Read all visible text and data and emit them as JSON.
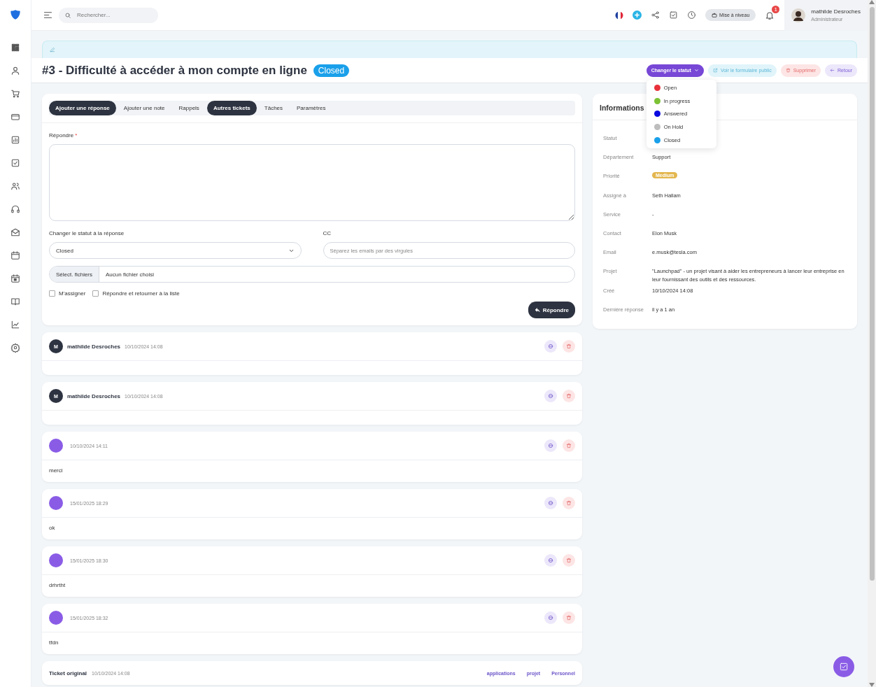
{
  "topbar": {
    "search": {
      "placeholder": "Rechercher..."
    },
    "upgrade_button": "Mise à niveau",
    "notifications_count": "1",
    "user": {
      "name": "mathilde Desroches",
      "role": "Administrateur"
    }
  },
  "ticket": {
    "title": "#3 - Difficulté à accéder à mon compte en ligne",
    "status": "Closed"
  },
  "actions": [
    {
      "kind": "status",
      "label": "Changer le statut"
    },
    {
      "kind": "public",
      "label": "Voir le formulaire public"
    },
    {
      "kind": "delete",
      "label": "Supprimer"
    },
    {
      "kind": "back",
      "label": "Retour"
    }
  ],
  "status_menu": [
    {
      "label": "Open",
      "color": "#e8313b"
    },
    {
      "label": "In progress",
      "color": "#7cc234"
    },
    {
      "label": "Answered",
      "color": "#0a0ae0"
    },
    {
      "label": "On Hold",
      "color": "#bdbdbd"
    },
    {
      "label": "Closed",
      "color": "#1aa0ea"
    }
  ],
  "reply": {
    "tabs": [
      {
        "label": "Ajouter une réponse",
        "selected": true
      },
      {
        "label": "Ajouter une note",
        "selected": false
      },
      {
        "label": "Rappels",
        "selected": false
      },
      {
        "label": "Autres tickets",
        "selected": true
      },
      {
        "label": "Tâches",
        "selected": false
      },
      {
        "label": "Paramètres",
        "selected": false
      }
    ],
    "reply_label": "Répondre",
    "required_mark": "*",
    "status_label": "Changer le statut à la réponse",
    "status_value": "Closed",
    "cc_label": "CC",
    "cc_placeholder": "Séparez les emails par des virgules",
    "file_button": "Sélect. fichiers",
    "file_status": "Aucun fichier choisi",
    "checkboxes": [
      {
        "label": "M'assigner",
        "checked": false
      },
      {
        "label": "Répondre et retourner à la liste",
        "checked": false
      }
    ],
    "submit": "Répondre"
  },
  "messages": [
    {
      "initial": "M",
      "author": "mathilde Desroches",
      "date": "10/10/2024 14:08"
    },
    {
      "initial": "M",
      "author": "mathilde Desroches",
      "date": "10/10/2024 14:08"
    },
    {
      "date": "10/10/2024 14:11",
      "body": "merci"
    },
    {
      "date": "15/01/2025 18:29",
      "body": "ok"
    },
    {
      "date": "15/01/2025 18:30",
      "body": "drhrtht"
    },
    {
      "date": "15/01/2025 18:32",
      "body": "tfdn"
    }
  ],
  "original_ticket": {
    "title": "Ticket original",
    "date": "10/10/2024 14:08",
    "tags": [
      "applications",
      "projet",
      "Personnel"
    ]
  },
  "info": {
    "title": "Informations",
    "rows": [
      {
        "label": "Statut"
      },
      {
        "label": "Département",
        "value": "Support"
      },
      {
        "label": "Priorité",
        "value": "Medium",
        "kind": "badge"
      },
      {
        "label": "Assigné à",
        "value": "Seth Hallam"
      },
      {
        "label": "Service",
        "value": "-"
      },
      {
        "label": "Contact",
        "value": "Elon Musk"
      },
      {
        "label": "Email",
        "value": "e.musk@tesla.com"
      },
      {
        "label": "Projet",
        "value": "\"Launchpad\" - un projet visant à aider les entrepreneurs à lancer leur entreprise en leur fournissant des outils et des ressources."
      },
      {
        "label": "Créé",
        "value": "10/10/2024 14:08"
      },
      {
        "label": "Dernière réponse",
        "value": "il y a 1 an"
      }
    ]
  }
}
